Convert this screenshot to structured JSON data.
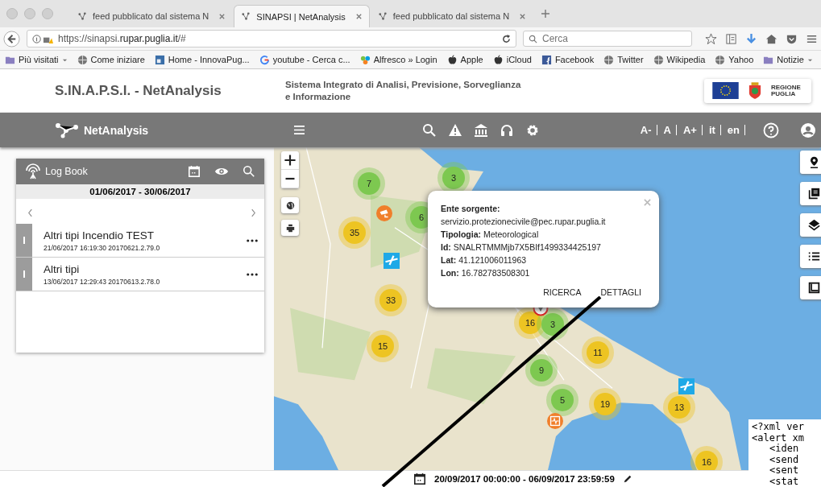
{
  "browser": {
    "tabs": [
      {
        "title": "feed pubblicato dal sistema N",
        "selected": false
      },
      {
        "title": "SINAPSI | NetAnalysis",
        "selected": true
      },
      {
        "title": "feed pubblicato dal sistema N",
        "selected": false
      }
    ],
    "url": "https://sinapsi.**rupar.puglia.it**/#",
    "search": {
      "placeholder": "Cerca"
    },
    "bookmarks": [
      {
        "label": "Più visitati",
        "kind": "folder",
        "dropdown": true
      },
      {
        "label": "Come iniziare",
        "kind": "globe",
        "dropdown": false
      },
      {
        "label": "Home - InnovaPug...",
        "kind": "page",
        "dropdown": false
      },
      {
        "label": "youtube - Cerca c...",
        "kind": "google",
        "dropdown": false
      },
      {
        "label": "Alfresco » Login",
        "kind": "flower",
        "dropdown": false
      },
      {
        "label": "Apple",
        "kind": "apple",
        "dropdown": false
      },
      {
        "label": "iCloud",
        "kind": "apple",
        "dropdown": false
      },
      {
        "label": "Facebook",
        "kind": "facebook",
        "dropdown": false
      },
      {
        "label": "Twitter",
        "kind": "globe",
        "dropdown": false
      },
      {
        "label": "Wikipedia",
        "kind": "globe",
        "dropdown": false
      },
      {
        "label": "Yahoo",
        "kind": "globe",
        "dropdown": false
      },
      {
        "label": "Notizie",
        "kind": "folder",
        "dropdown": true
      }
    ]
  },
  "header": {
    "title": "S.IN.A.P.S.I. - NetAnalysis",
    "subtitle": "Sistema Integrato di Analisi, Previsione, Sorveglianza e Informazione",
    "region_logo": "REGIONE PUGLIA"
  },
  "navbar": {
    "brand": "NetAnalysis",
    "font_sizes": [
      "A-",
      "A",
      "A+"
    ],
    "languages": [
      "it",
      "en"
    ]
  },
  "logbook": {
    "title": "Log Book",
    "date_range": "01/06/2017 - 30/06/2017",
    "entries": [
      {
        "title": "Altri tipi Incendio TEST",
        "meta": "21/06/2017 16:19:30 20170621.2.79.0"
      },
      {
        "title": "Altri tipi",
        "meta": "13/06/2017 12:29:43 20170613.2.78.0"
      }
    ]
  },
  "map": {
    "clusters": [
      {
        "count": "7",
        "color": "#7dc850"
      },
      {
        "count": "3",
        "color": "#7dc850"
      },
      {
        "count": "6",
        "color": "#7dc850"
      },
      {
        "count": "35",
        "color": "#edc422"
      },
      {
        "count": "33",
        "color": "#edc422"
      },
      {
        "count": "16",
        "color": "#edc422"
      },
      {
        "count": "3",
        "color": "#7dc850"
      },
      {
        "count": "15",
        "color": "#edc422"
      },
      {
        "count": "11",
        "color": "#edc422"
      },
      {
        "count": "9",
        "color": "#7dc850"
      },
      {
        "count": "5",
        "color": "#7dc850"
      },
      {
        "count": "19",
        "color": "#edc422"
      },
      {
        "count": "13",
        "color": "#edc422"
      },
      {
        "count": "16",
        "color": "#edc422"
      }
    ],
    "popup": {
      "fields": [
        {
          "label": "Ente sorgente:",
          "value": "servizio.protezionecivile@pec.rupar.puglia.it",
          "kind": "stacked"
        },
        {
          "label": "Tipologia:",
          "value": "Meteorological",
          "kind": "inline"
        },
        {
          "label": "Id:",
          "value": "SNALRTMMMjb7X5BIf1499334425197",
          "kind": "inline"
        },
        {
          "label": "Lat:",
          "value": "41.121006011963",
          "kind": "inline"
        },
        {
          "label": "Lon:",
          "value": "16.782783508301",
          "kind": "inline"
        }
      ],
      "actions": [
        "RICERCA",
        "DETTAGLI"
      ]
    }
  },
  "xml_lines": [
    "<?xml ver",
    "<alert xm",
    "<iden",
    "<send",
    "<sent",
    "<stat"
  ],
  "bottom_bar": {
    "range": "20/09/2017 00:00:00 - 06/09/2017 23:59:59"
  }
}
